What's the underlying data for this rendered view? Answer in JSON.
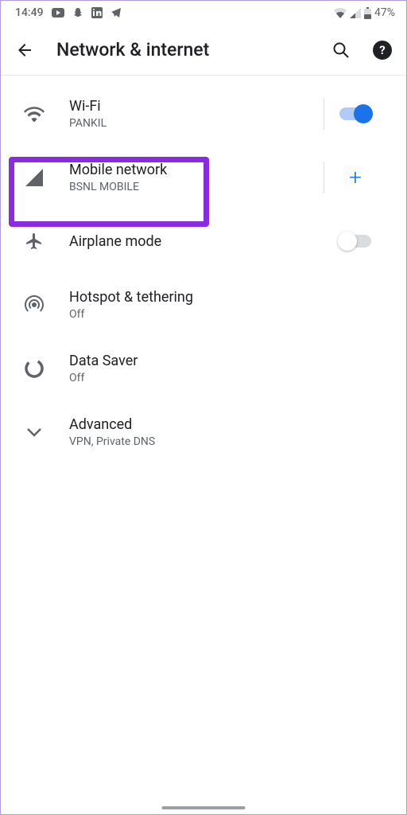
{
  "status": {
    "time": "14:49",
    "battery": "47%"
  },
  "header": {
    "title": "Network & internet"
  },
  "rows": {
    "wifi": {
      "title": "Wi-Fi",
      "sub": "PANKIL"
    },
    "mobile": {
      "title": "Mobile network",
      "sub": "BSNL MOBILE"
    },
    "airplane": {
      "title": "Airplane mode"
    },
    "hotspot": {
      "title": "Hotspot & tethering",
      "sub": "Off"
    },
    "datasaver": {
      "title": "Data Saver",
      "sub": "Off"
    },
    "advanced": {
      "title": "Advanced",
      "sub": "VPN, Private DNS"
    }
  },
  "help_glyph": "?"
}
